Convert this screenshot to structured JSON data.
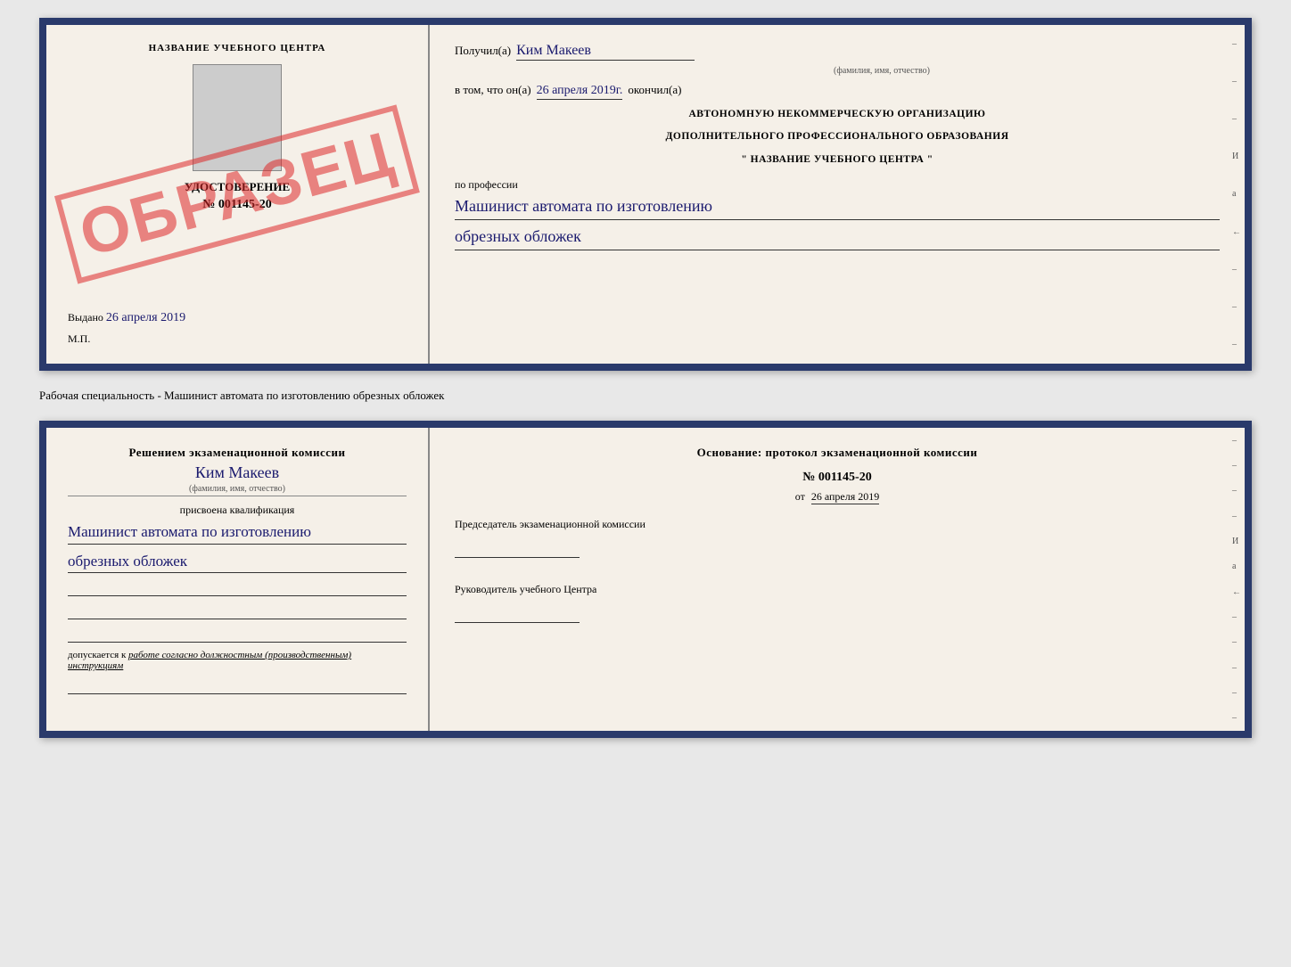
{
  "card1": {
    "left": {
      "center_title": "НАЗВАНИЕ УЧЕБНОГО ЦЕНТРА",
      "stamp_text": "ОБРАЗЕЦ",
      "doc_label": "УДОСТОВЕРЕНИЕ",
      "doc_number": "№ 001145-20",
      "issued_label": "Выдано",
      "issued_date": "26 апреля 2019",
      "mp_label": "М.П."
    },
    "right": {
      "poluchil_label": "Получил(а)",
      "recipient_name": "Ким Макеев",
      "fio_label": "(фамилия, имя, отчество)",
      "vtom_label": "в том, что он(а)",
      "date_completed": "26 апреля 2019г.",
      "okonchil_label": "окончил(а)",
      "org_line1": "АВТОНОМНУЮ НЕКОММЕРЧЕСКУЮ ОРГАНИЗАЦИЮ",
      "org_line2": "ДОПОЛНИТЕЛЬНОГО ПРОФЕССИОНАЛЬНОГО ОБРАЗОВАНИЯ",
      "org_line3": "\"  НАЗВАНИЕ УЧЕБНОГО ЦЕНТРА  \"",
      "po_professii_label": "по профессии",
      "profession_line1": "Машинист автомата по изготовлению",
      "profession_line2": "обрезных обложек"
    }
  },
  "section_label": "Рабочая специальность - Машинист автомата по изготовлению обрезных обложек",
  "card2": {
    "left": {
      "resheniem_label": "Решением экзаменационной комиссии",
      "name": "Ким Макеев",
      "fio_label": "(фамилия, имя, отчество)",
      "prisvoena_label": "присвоена квалификация",
      "kvalif_line1": "Машинист автомата по изготовлению",
      "kvalif_line2": "обрезных обложек",
      "dopusk_label": "допускается к",
      "dopusk_text": "работе согласно должностным (производственным) инструкциям"
    },
    "right": {
      "osnov_label": "Основание: протокол экзаменационной комиссии",
      "proto_number": "№ 001145-20",
      "proto_date_prefix": "от",
      "proto_date": "26 апреля 2019",
      "predsedatel_label": "Председатель экзаменационной комиссии",
      "rukovoditel_label": "Руководитель учебного Центра"
    }
  },
  "margin_ticks": [
    "-",
    "-",
    "-",
    "И",
    "а̃",
    "←",
    "-",
    "-",
    "-",
    "-"
  ],
  "margin_ticks2": [
    "-",
    "-",
    "-",
    "-",
    "И",
    "а̃",
    "←",
    "-",
    "-",
    "-",
    "-",
    "-"
  ]
}
